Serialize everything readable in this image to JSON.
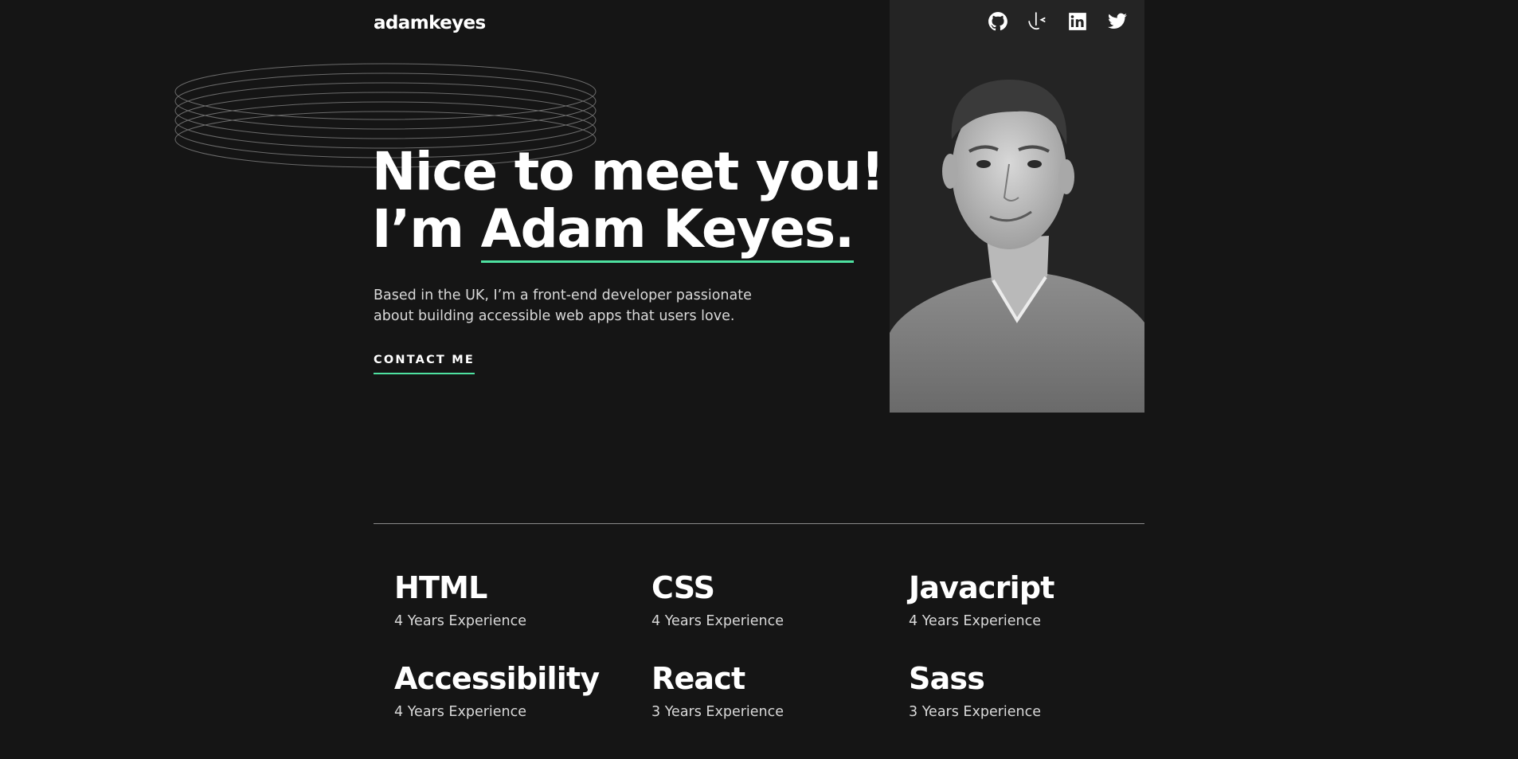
{
  "header": {
    "logo": "adamkeyes",
    "socials": [
      {
        "name": "GitHub",
        "icon": "github-icon"
      },
      {
        "name": "Frontend Mentor",
        "icon": "frontend-mentor-icon"
      },
      {
        "name": "LinkedIn",
        "icon": "linkedin-icon"
      },
      {
        "name": "Twitter",
        "icon": "twitter-icon"
      }
    ]
  },
  "hero": {
    "headline_line1": "Nice to meet you!",
    "headline_prefix": "I’m ",
    "headline_name": "Adam Keyes.",
    "intro": "Based in the UK, I’m a front-end developer passionate about building accessible web apps that users love.",
    "contact_label": "CONTACT ME",
    "photo_alt": "Portrait photo of Adam Keyes",
    "accent_color": "#4ee1a0"
  },
  "skills": [
    {
      "name": "HTML",
      "experience": "4 Years Experience"
    },
    {
      "name": "CSS",
      "experience": "4 Years Experience"
    },
    {
      "name": "Javacript",
      "experience": "4 Years Experience"
    },
    {
      "name": "Accessibility",
      "experience": "4 Years Experience"
    },
    {
      "name": "React",
      "experience": "3 Years Experience"
    },
    {
      "name": "Sass",
      "experience": "3 Years Experience"
    }
  ]
}
